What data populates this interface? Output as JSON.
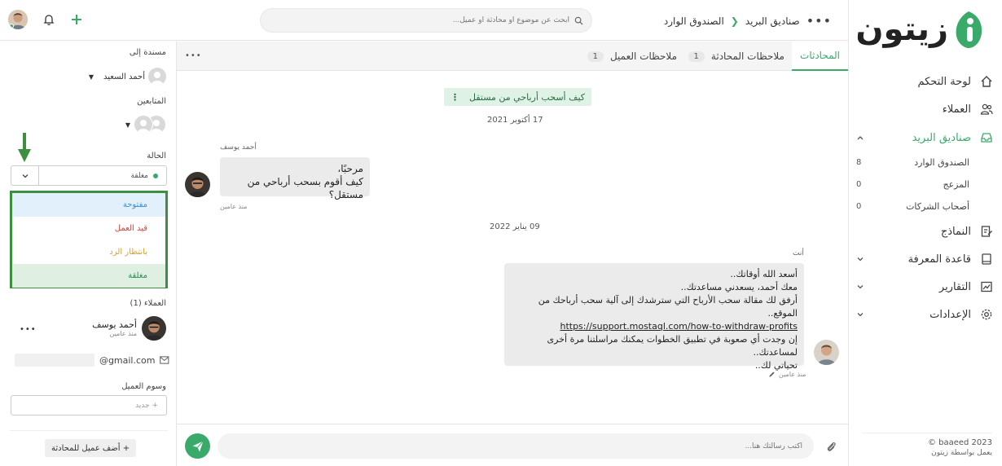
{
  "brand": {
    "name": "زيتون",
    "accent": "#3aaa6a"
  },
  "nav": {
    "items": [
      {
        "label": "لوحة التحكم",
        "icon": "home-icon"
      },
      {
        "label": "العملاء",
        "icon": "users-icon"
      },
      {
        "label": "صناديق البريد",
        "icon": "inbox-icon"
      },
      {
        "label": "النماذج",
        "icon": "forms-icon"
      },
      {
        "label": "قاعدة المعرفة",
        "icon": "book-icon"
      },
      {
        "label": "التقارير",
        "icon": "chart-icon"
      },
      {
        "label": "الإعدادات",
        "icon": "gear-icon"
      }
    ],
    "mailboxes": [
      {
        "label": "الصندوق الوارد",
        "count": "8"
      },
      {
        "label": "المزعج",
        "count": "0"
      },
      {
        "label": "أصحاب الشركات",
        "count": "0"
      }
    ]
  },
  "footer": {
    "copyright": "© baaeed 2023",
    "powered": "يعمل بواسطة زيتون"
  },
  "header": {
    "breadcrumb": [
      "صناديق البريد",
      "الصندوق الوارد"
    ],
    "search_placeholder": "ابحث عن موضوع أو محادثة أو عميل..."
  },
  "tabs": [
    {
      "label": "المحادثات",
      "badge": ""
    },
    {
      "label": "ملاحظات المحادثة",
      "badge": "1"
    },
    {
      "label": "ملاحظات العميل",
      "badge": "1"
    }
  ],
  "left": {
    "assigned_label": "مسندة إلى",
    "assigned_name": "أحمد السعيد",
    "followers_label": "المتابعين",
    "status_label": "الحالة",
    "status_value": "مغلقة",
    "status_options": [
      {
        "label": "مفتوحة",
        "color": "#3b8ed6",
        "bg": "#e1f0fb"
      },
      {
        "label": "قيد العمل",
        "color": "#d0453a",
        "bg": "#ffffff"
      },
      {
        "label": "بانتظار الرد",
        "color": "#d9a23a",
        "bg": "#ffffff"
      },
      {
        "label": "مغلقة",
        "color": "#2f8f55",
        "bg": "#dff0e2"
      }
    ],
    "customers_label": "العملاء (1)",
    "customer_name": "أحمد يوسف",
    "customer_time": "منذ عامين",
    "customer_email": "@gmail.com",
    "tags_label": "وسوم العميل",
    "tags_placeholder": "+ جديد",
    "add_customer": "+ أضف عميل للمحادثة"
  },
  "conversation": {
    "subject": "كيف أسحب أرباحي من مستقل",
    "date1": "17 أكتوبر 2021",
    "sender1": "أحمد يوسف",
    "msg1_line1": "مرحبًا،",
    "msg1_line2": "كيف أقوم بسحب أرباحي من مستقل؟",
    "time1": "منذ عامين",
    "date2": "09 يناير 2022",
    "sender2": "أنت",
    "msg2_lines": [
      "أسعد الله أوقاتك..",
      "معك أحمد، يسعدني مساعدتك..",
      "أرفق لك مقالة سحب الأرباح التي سترشدك إلى آلية سحب أرباحك من الموقع..",
      "https://support.mostaql.com/how-to-withdraw-profits",
      "إن وجدت أي صعوبة في تطبيق الخطوات يمكنك مراسلتنا مرة أخرى لمساعدتك..",
      "تحياتي لك.."
    ],
    "time2": "منذ عامين"
  },
  "composer": {
    "placeholder": "اكتب رسالتك هنا..."
  }
}
